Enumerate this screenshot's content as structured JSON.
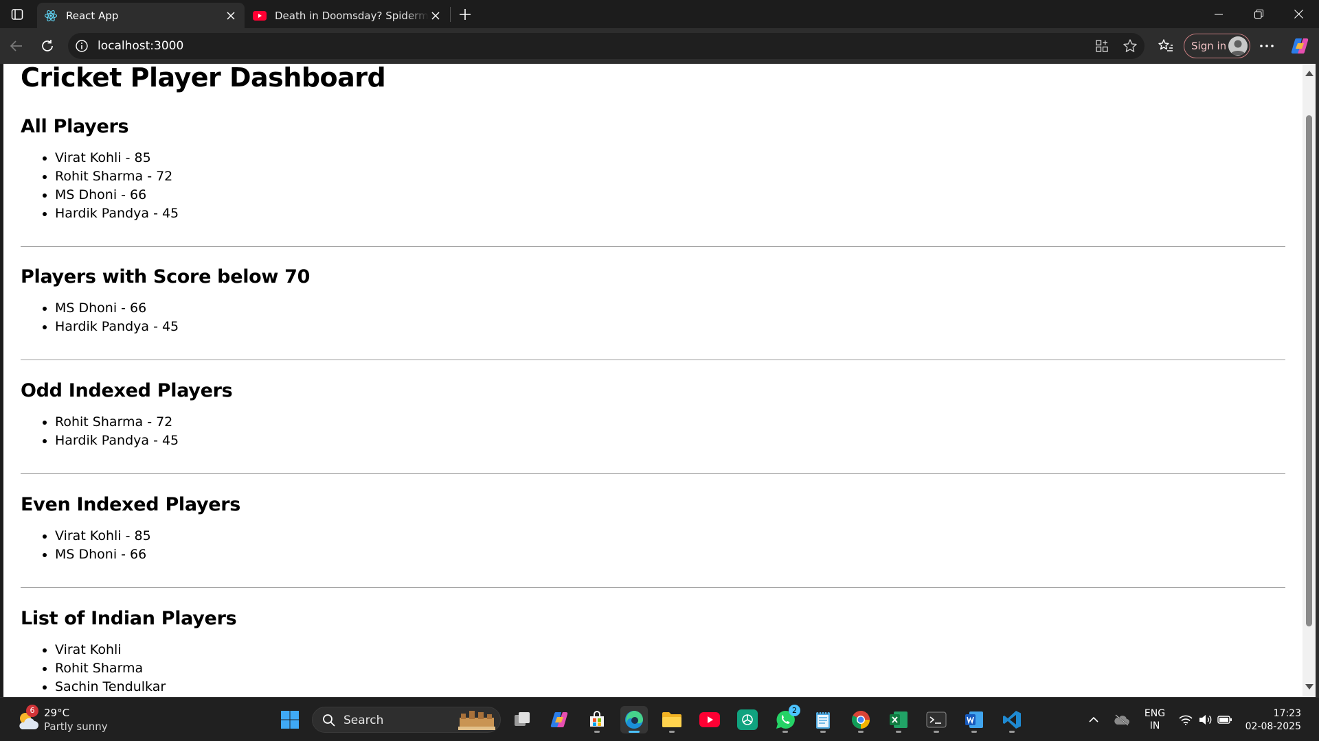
{
  "browser": {
    "tabs": [
      {
        "title": "React App",
        "icon": "react-icon",
        "active": true
      },
      {
        "title": "Death in Doomsday? Spiderman & Iron Man",
        "icon": "youtube-icon",
        "active": false
      }
    ],
    "url": "localhost:3000",
    "signin_label": "Sign in",
    "accent": "#4cc2ff"
  },
  "page": {
    "title": "Cricket Player Dashboard",
    "sections": [
      {
        "heading": "All Players",
        "items": [
          "Virat Kohli - 85",
          "Rohit Sharma - 72",
          "MS Dhoni - 66",
          "Hardik Pandya - 45"
        ]
      },
      {
        "heading": "Players with Score below 70",
        "items": [
          "MS Dhoni - 66",
          "Hardik Pandya - 45"
        ]
      },
      {
        "heading": "Odd Indexed Players",
        "items": [
          "Rohit Sharma - 72",
          "Hardik Pandya - 45"
        ]
      },
      {
        "heading": "Even Indexed Players",
        "items": [
          "Virat Kohli - 85",
          "MS Dhoni - 66"
        ]
      },
      {
        "heading": "List of Indian Players",
        "items": [
          "Virat Kohli",
          "Rohit Sharma",
          "Sachin Tendulkar"
        ]
      }
    ]
  },
  "taskbar": {
    "weather": {
      "temp": "29°C",
      "desc": "Partly sunny",
      "badge": "6"
    },
    "search_label": "Search",
    "whatsapp_badge": "2",
    "lang_line1": "ENG",
    "lang_line2": "IN",
    "time": "17:23",
    "date": "02-08-2025"
  }
}
